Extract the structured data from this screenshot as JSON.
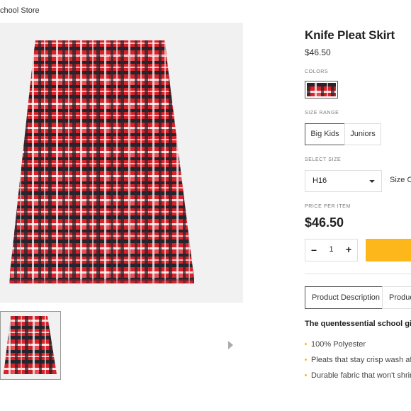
{
  "breadcrumb": {
    "text": "chool Store"
  },
  "product": {
    "title": "Knife Pleat Skirt",
    "price": "$46.50"
  },
  "colors": {
    "label": "COLORS",
    "swatch_name": "plaid-swatch"
  },
  "size_range": {
    "label": "SIZE RANGE",
    "options": [
      {
        "label": "Big Kids",
        "selected": true
      },
      {
        "label": "Juniors",
        "selected": false
      }
    ]
  },
  "select_size": {
    "label": "SELECT SIZE",
    "value": "H16",
    "size_chart_link": "Size Ch"
  },
  "price_per_item": {
    "label": "PRICE PER ITEM",
    "value": "$46.50"
  },
  "quantity": {
    "minus": "–",
    "value": "1",
    "plus": "+"
  },
  "tabs": [
    {
      "label": "Product Description",
      "active": true
    },
    {
      "label": "Produc",
      "active": false
    }
  ],
  "description": {
    "heading": "The quentessential school girl sk",
    "bullets": [
      "100% Polyester",
      "Pleats that stay crisp wash afte",
      "Durable fabric that won't shrink"
    ]
  },
  "theme": {
    "accent": "#fdb71a",
    "plaid_red": "#e02a30",
    "plaid_dark": "#2a2a33",
    "plaid_white": "#ffffff"
  }
}
